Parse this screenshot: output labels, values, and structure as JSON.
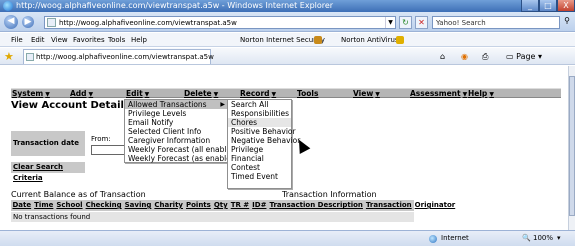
{
  "window": {
    "title": "http://woog.alphafiveonline.com/viewtranspat.a5w - Windows Internet Explorer",
    "controls": {
      "minimize": "_",
      "maximize": "□",
      "close": "X"
    }
  },
  "address": {
    "url": "http://woog.alphafiveonline.com/viewtranspat.a5w",
    "search_placeholder": "Yahoo! Search"
  },
  "menubar": {
    "items": [
      "File",
      "Edit",
      "View",
      "Favorites",
      "Tools",
      "Help"
    ],
    "norton_security": "Norton Internet Security",
    "norton_antivirus": "Norton AntiVirus"
  },
  "tab": {
    "label": "http://woog.alphafiveonline.com/viewtranspat.a5w"
  },
  "commandbar": {
    "page": "Page"
  },
  "appmenu": {
    "items": [
      "System",
      "Add",
      "Edit",
      "Delete",
      "Record",
      "Tools",
      "View",
      "Assessment",
      "Help"
    ]
  },
  "page": {
    "title": "View Account Detail",
    "transaction_date": "Transaction date",
    "from_label": "From:",
    "clear_search": "Clear Search Criteria",
    "balance": "Current Balance as of Transaction",
    "transaction_info": "Transaction Information",
    "columns": [
      "Date",
      "Time",
      "School",
      "Checking",
      "Saving",
      "Charity",
      "Points",
      "Qty",
      "TR #",
      "ID#",
      "Transaction Description",
      "Transaction",
      "Originator"
    ],
    "empty": "No transactions found"
  },
  "edit_menu": {
    "items": [
      "Allowed Transactions",
      "Privilege Levels",
      "Email Notify",
      "Selected Client Info",
      "Caregiver Information",
      "Weekly Forecast (all enabled)",
      "Weekly Forecast (as enabled)"
    ],
    "submenu_arrow": "▶"
  },
  "submenu": {
    "items": [
      "Search All",
      "Responsibilities",
      "Chores",
      "Positive Behavior",
      "Negative Behavior",
      "Privilege",
      "Financial",
      "Contest",
      "Timed Event"
    ]
  },
  "status": {
    "zone": "Internet",
    "zoom": "100%"
  }
}
